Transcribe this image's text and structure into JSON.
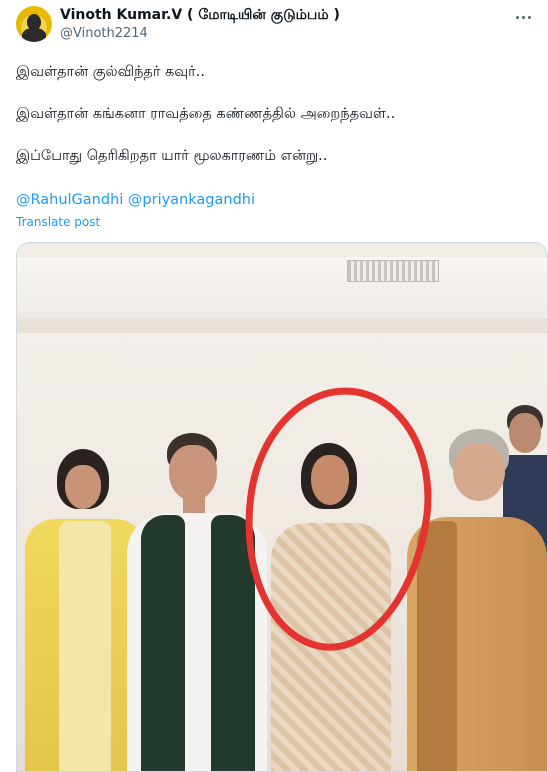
{
  "author": {
    "name": "Vinoth Kumar.V ( மோடியின் குடும்பம் )",
    "handle": "@Vinoth2214",
    "avatar_icon": "avatar-photo"
  },
  "post": {
    "lines": [
      "இவள்தான் குல்விந்தர் கவுர்..",
      "இவள்தான் கங்கனா ராவத்தை கண்ணத்தில் அறைந்தவள்..",
      "இப்போது தெரிகிறதா யார் மூலகாரணம் என்று.."
    ],
    "mentions": [
      "@RahulGandhi",
      "@priyankagandhi"
    ],
    "translate_label": "Translate post"
  },
  "colors": {
    "accent": "#1d9bf0",
    "circle_annotation": "#e3342f"
  }
}
